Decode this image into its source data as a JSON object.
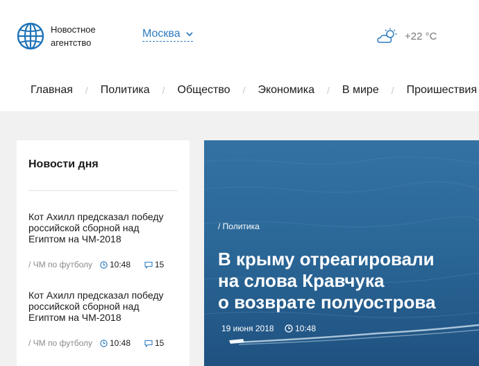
{
  "brand": {
    "name_line1": "Новостное",
    "name_line2": "агентство",
    "icon": "globe-icon"
  },
  "city": {
    "name": "Москва",
    "icon": "chevron-down-icon"
  },
  "weather": {
    "temperature": "+22 °C",
    "icon": "partly-cloudy-icon"
  },
  "nav": {
    "items": [
      {
        "label": "Главная"
      },
      {
        "label": "Политика"
      },
      {
        "label": "Общество"
      },
      {
        "label": "Экономика"
      },
      {
        "label": "В мире"
      },
      {
        "label": "Проишествия"
      }
    ],
    "separator": "/"
  },
  "news_of_day": {
    "title": "Новости дня",
    "items": [
      {
        "title": "Кот Ахилл предсказал победу российской сборной над Египтом на ЧМ-2018",
        "category": "/ ЧМ по футболу",
        "time": "10:48",
        "comments": "15"
      },
      {
        "title": "Кот Ахилл предсказал победу российской сборной над Египтом на ЧМ-2018",
        "category": "/ ЧМ по футболу",
        "time": "10:48",
        "comments": "15"
      }
    ]
  },
  "featured": {
    "category": "/ Политика",
    "title_line1": "В крыму отреагировали",
    "title_line2": "на слова Кравчука",
    "title_line3": "о возврате полуострова",
    "date": "19 июня 2018",
    "time": "10:48"
  },
  "colors": {
    "accent": "#2d7bc1",
    "header_bg": "#ffffff",
    "page_bg": "#f1f1f1",
    "muted": "#8a8a8a"
  }
}
